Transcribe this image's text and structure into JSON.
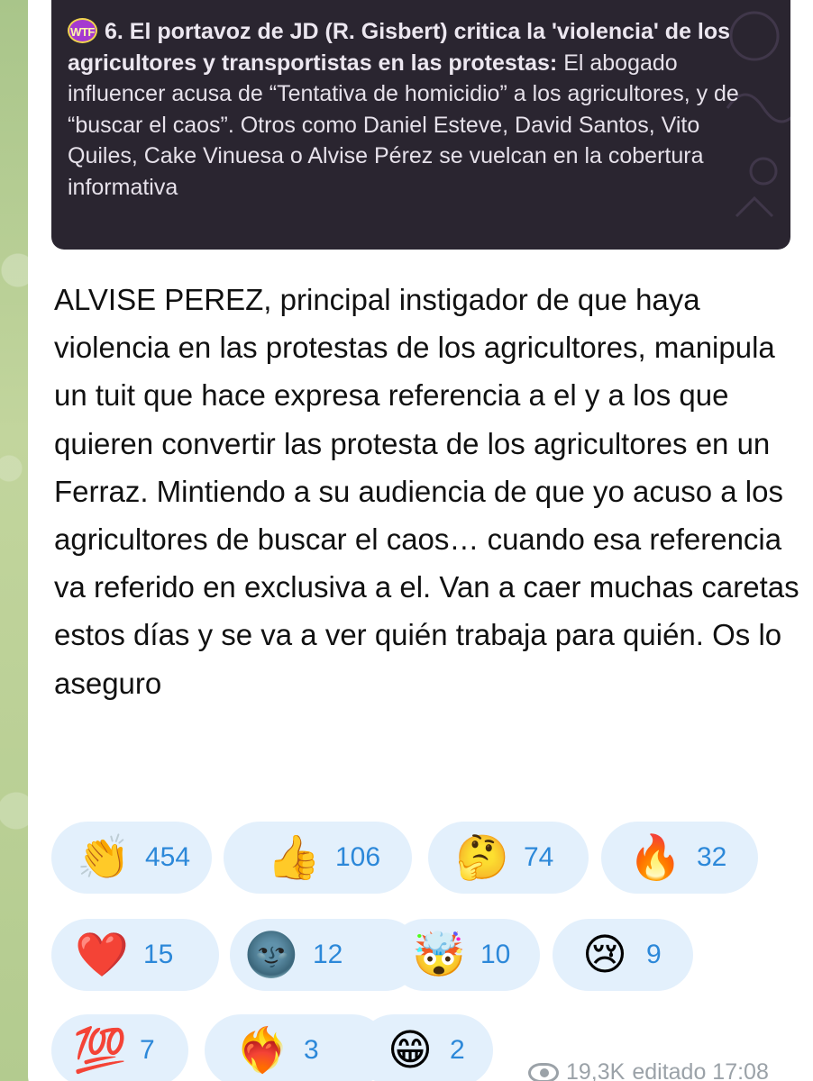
{
  "reply": {
    "badge": "WTF",
    "title": "6. El portavoz de JD (R. Gisbert) critica la 'violencia' de los agricultores y transportistas en las protestas:",
    "body": " El abogado influencer acusa de “Tentativa de homicidio” a los agricultores, y de “buscar el caos”. Otros como Daniel Esteve, David Santos, Vito Quiles, Cake Vinuesa o Alvise Pérez se vuelcan en la cobertura informativa"
  },
  "message": {
    "text": "ALVISE PEREZ, principal instigador de que haya violencia en las protestas de los agricultores, manipula un tuit que hace expresa referencia a el y a los que quieren convertir las protesta de los agricultores en un Ferraz. Mintiendo a su audiencia de que yo acuso a los agricultores de buscar el caos… cuando esa referencia va referido en exclusiva a el. Van a caer muchas caretas estos días y se va a ver quién trabaja para quién. Os lo aseguro"
  },
  "reactions": [
    {
      "icon": "clapping-hands-icon",
      "emoji": "👏",
      "count": "454"
    },
    {
      "icon": "thumbs-up-icon",
      "emoji": "👍",
      "count": "106"
    },
    {
      "icon": "thinking-face-icon",
      "emoji": "🤔",
      "count": "74"
    },
    {
      "icon": "fire-icon",
      "emoji": "🔥",
      "count": "32"
    },
    {
      "icon": "red-heart-icon",
      "emoji": "❤️",
      "count": "15"
    },
    {
      "icon": "new-moon-face-icon",
      "emoji": "🌚",
      "count": "12"
    },
    {
      "icon": "exploding-head-icon",
      "emoji": "🤯",
      "count": "10"
    },
    {
      "icon": "crying-face-icon",
      "emoji": "😢",
      "count": "9"
    },
    {
      "icon": "hundred-points-icon",
      "emoji": "💯",
      "count": "7"
    },
    {
      "icon": "heart-on-fire-icon",
      "emoji": "❤️‍🔥",
      "count": "3"
    },
    {
      "icon": "grinning-face-icon",
      "emoji": "😁",
      "count": "2"
    }
  ],
  "meta": {
    "views": "19,3K",
    "status": "editado 17:08"
  },
  "colors": {
    "reaction_bg": "#e3f0fc",
    "reaction_count": "#2c88d9",
    "reply_bg": "#2a2530",
    "wallpaper": "#b9cf9a"
  }
}
